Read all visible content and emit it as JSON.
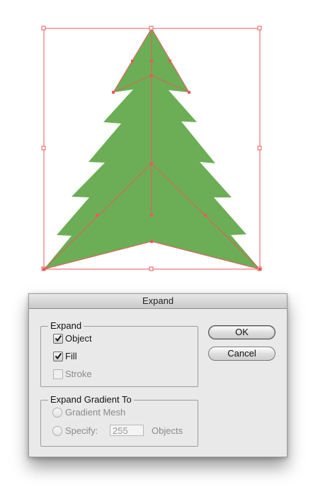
{
  "dialog": {
    "title": "Expand",
    "expand_group": {
      "legend": "Expand",
      "options": [
        {
          "label": "Object",
          "checked": true,
          "enabled": true
        },
        {
          "label": "Fill",
          "checked": true,
          "enabled": true
        },
        {
          "label": "Stroke",
          "checked": false,
          "enabled": false
        }
      ]
    },
    "gradient_group": {
      "legend": "Expand Gradient To",
      "gradient_mesh_label": "Gradient Mesh",
      "specify_label": "Specify:",
      "specify_value": "255",
      "objects_label": "Objects"
    },
    "buttons": {
      "ok": "OK",
      "cancel": "Cancel"
    }
  },
  "artwork": {
    "object": "tree shape",
    "fill_color": "#6cae55",
    "selection_color": "#e85050"
  }
}
